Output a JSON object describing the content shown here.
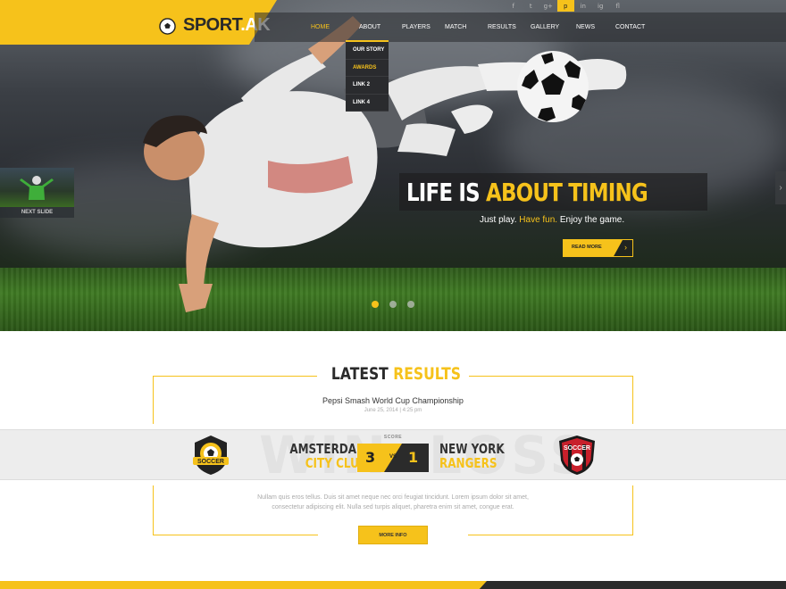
{
  "brand": {
    "name_main": "SPORT",
    "name_suffix": ".AK",
    "accent": "#f6c21b"
  },
  "social": [
    "f",
    "t",
    "g+",
    "p",
    "in",
    "ig",
    "fl"
  ],
  "nav": [
    {
      "label": "HOME",
      "active": true
    },
    {
      "label": "ABOUT",
      "active": false
    },
    {
      "label": "PLAYERS",
      "active": false
    },
    {
      "label": "MATCH",
      "active": false
    },
    {
      "label": "RESULTS",
      "active": false
    },
    {
      "label": "GALLERY",
      "active": false
    },
    {
      "label": "NEWS",
      "active": false
    },
    {
      "label": "CONTACT",
      "active": false
    }
  ],
  "dropdown": [
    "OUR STORY",
    "AWARDS",
    "LINK 2",
    "LINK 4"
  ],
  "slide": {
    "headline_a": "LIFE IS ",
    "headline_b": "ABOUT TIMING",
    "sub_a": "Just play. ",
    "sub_b": "Have fun.",
    "sub_c": " Enjoy the game.",
    "cta": "READ MORE",
    "next": "NEXT SLIDE",
    "dots": 3
  },
  "results": {
    "title_a": "LATEST ",
    "title_b": "RESULTS",
    "event": "Pepsi Smash World Cup Championship",
    "date": "June 25, 2014 | 4:25 pm",
    "ghost_left": "WIN",
    "ghost_right": "LOSS",
    "home_name": "AMSTERDAM",
    "home_club": "CITY CLUB",
    "away_name": "NEW YORK",
    "away_club": "RANGERS",
    "score_label": "SCORE",
    "score_home": "3",
    "score_vs": "VS",
    "score_away": "1",
    "crest_text": "SOCCER",
    "lorem_1": "Nullam quis eros tellus. Duis sit amet neque nec orci feugiat tincidunt. Lorem ipsum dolor sit amet,",
    "lorem_2": "consectetur adipiscing elit. Nulla sed turpis aliquet, pharetra enim sit amet, congue erat.",
    "more": "MORE INFO"
  }
}
